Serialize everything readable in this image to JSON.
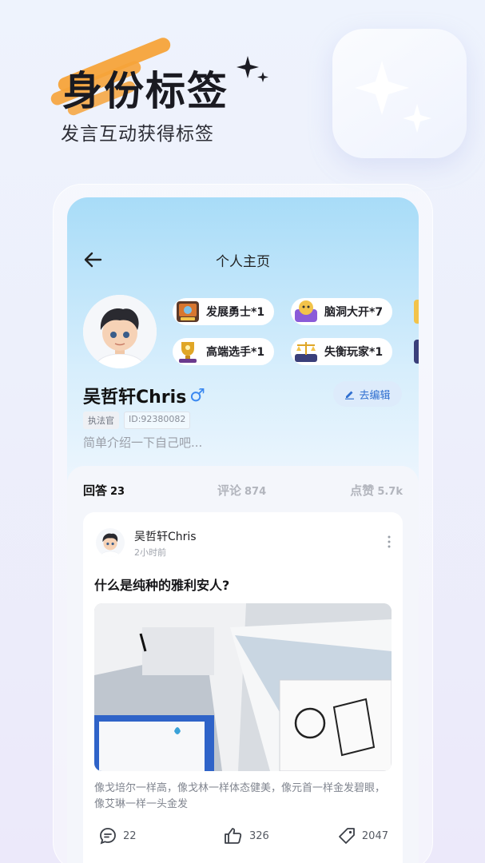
{
  "promo": {
    "title": "身份标签",
    "subtitle": "发言互动获得标签"
  },
  "nav": {
    "title": "个人主页"
  },
  "profile": {
    "name": "吴哲轩Chris",
    "gender_symbol": "♂",
    "edit_label": "去编辑",
    "role_tag": "执法官",
    "id_tag": "ID:92380082",
    "bio_placeholder": "简单介绍一下自己吧..."
  },
  "badges": [
    {
      "label": "发展勇士*1",
      "icon": "warrior-badge-icon",
      "color": "#d8762f"
    },
    {
      "label": "脑洞大开*7",
      "icon": "brainstorm-badge-icon",
      "color": "#8a5bd8"
    },
    {
      "label": "高端选手*1",
      "icon": "trophy-badge-icon",
      "color": "#e0a626"
    },
    {
      "label": "失衡玩家*1",
      "icon": "scale-badge-icon",
      "color": "#3a3f7a"
    }
  ],
  "tabs": [
    {
      "label": "回答",
      "count": "23",
      "active": true
    },
    {
      "label": "评论",
      "count": "874",
      "active": false
    },
    {
      "label": "点赞",
      "count": "5.7k",
      "active": false
    }
  ],
  "post": {
    "author": "吴哲轩Chris",
    "time": "2小时前",
    "question": "什么是纯种的雅利安人?",
    "description": "像戈培尔一样高，像戈林一样体态健美，像元首一样金发碧眼，像艾琳一样一头金发",
    "comments": "22",
    "likes": "326",
    "tags": "2047"
  },
  "colors": {
    "accent": "#2f6fd0",
    "brush": "#f6a33a",
    "gender": "#3a88f0"
  }
}
